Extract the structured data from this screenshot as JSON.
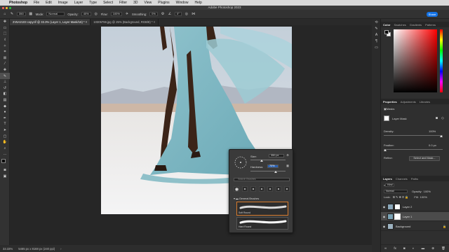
{
  "menubar": {
    "app_name": "Photoshop",
    "items": [
      "File",
      "Edit",
      "Image",
      "Layer",
      "Type",
      "Select",
      "Filter",
      "3D",
      "View",
      "Plugins",
      "Window",
      "Help"
    ]
  },
  "titlebar": {
    "title": "Adobe Photoshop 2023"
  },
  "options": {
    "brush_size": "350",
    "mode_label": "Mode:",
    "mode_value": "Normal",
    "opacity_label": "Opacity:",
    "opacity_value": "40%",
    "flow_label": "Flow:",
    "flow_value": "100%",
    "smoothing_label": "Smoothing:",
    "smoothing_value": "0%",
    "angle_value": "0°",
    "share_label": "Share"
  },
  "tabs": [
    {
      "label": "2V5A2103 copy.tif @ 33.3% (Layer 1, Layer Mask/16) *"
    },
    {
      "label": "10305759.jpg @ 25% (Background, RGB/8) *"
    }
  ],
  "status": {
    "zoom": "33.33%",
    "doc_info": "5465 px x 8168 px (240 ppi)"
  },
  "brush_panel": {
    "size_label": "Size:",
    "size_value": "350 px",
    "hardness_label": "Hardness:",
    "hardness_value": "70%",
    "search_placeholder": "Search Brushes",
    "folder_label": "General Brushes",
    "brushes": [
      {
        "label": "Soft Round"
      },
      {
        "label": "Hard Round"
      }
    ]
  },
  "panels": {
    "color_tabs": [
      "Color",
      "Swatches",
      "Gradients",
      "Patterns"
    ],
    "properties_tabs": [
      "Properties",
      "Adjustments",
      "Libraries"
    ],
    "pixel_label": "Masks",
    "layer_mask_label": "Layer Mask",
    "density_label": "Density:",
    "density_value": "100%",
    "feather_label": "Feather:",
    "feather_value": "0.0 px",
    "refine_label": "Refine:",
    "select_mask_label": "Select and Mask...",
    "layers_tabs": [
      "Layers",
      "Channels",
      "Paths"
    ],
    "kind_label": "Kind",
    "blend_mode": "Normal",
    "opacity_label": "Opacity:",
    "opacity_value": "100%",
    "lock_label": "Lock:",
    "fill_label": "Fill:",
    "fill_value": "100%",
    "layers": [
      {
        "name": "Layer 2"
      },
      {
        "name": "Layer 1"
      },
      {
        "name": "Background"
      }
    ]
  },
  "colors": {
    "accent": "#1473e6",
    "selection_orange": "#d67a2c",
    "panel_bg": "#2f2f2f",
    "canvas_bg": "#262626"
  }
}
